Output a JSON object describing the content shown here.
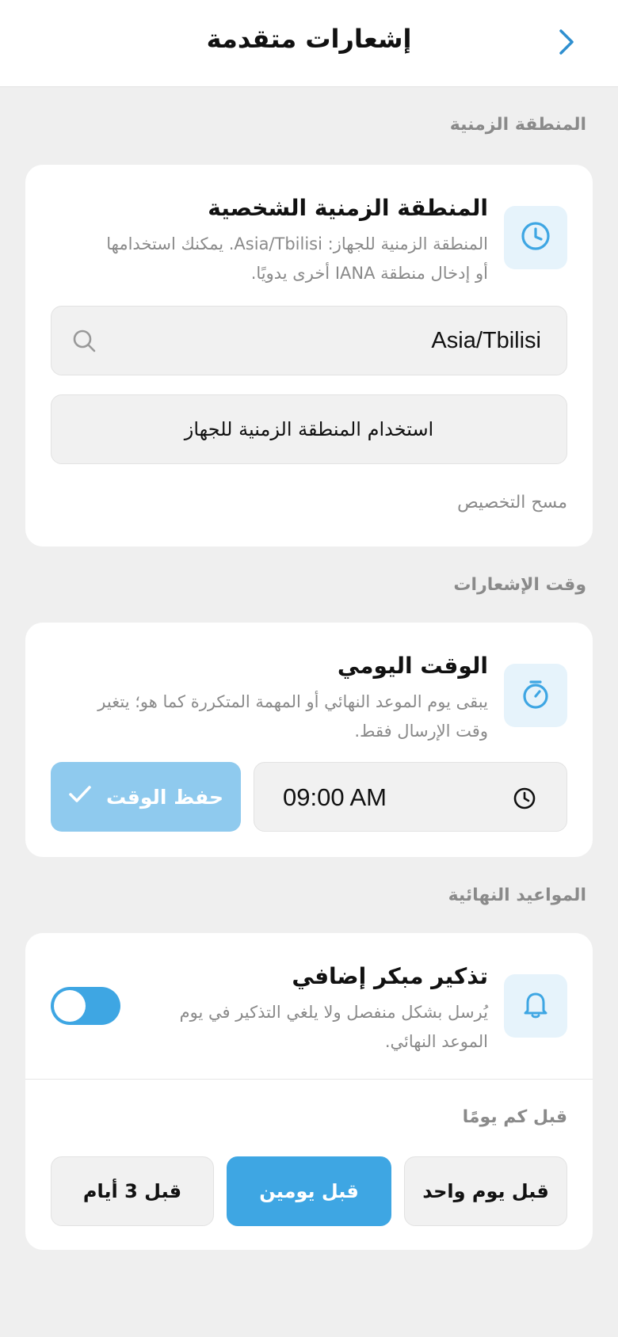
{
  "header": {
    "title": "إشعارات متقدمة",
    "back_icon": "chevron-right-icon"
  },
  "timezone_section": {
    "label": "المنطقة الزمنية",
    "card": {
      "icon": "clock-icon",
      "title": "المنطقة الزمنية الشخصية",
      "description_line1": "المنطقة الزمنية للجهاز: Asia/Tbilisi. يمكنك استخدامها",
      "description_line2": "أو إدخال منطقة IANA أخرى يدويًا.",
      "input_value": "Asia/Tbilisi",
      "search_icon": "search-icon",
      "use_device_label": "استخدام المنطقة الزمنية للجهاز",
      "reset_label": "مسح التخصيص"
    }
  },
  "notification_time_section": {
    "label": "وقت الإشعارات",
    "card": {
      "icon": "stopwatch-icon",
      "title": "الوقت اليومي",
      "description_line1": "يبقى يوم الموعد النهائي أو المهمة المتكررة كما هو؛ يتغير",
      "description_line2": "وقت الإرسال فقط.",
      "time_value": "09:00  AM",
      "time_icon": "clock-icon",
      "save_label": "حفظ الوقت",
      "save_icon": "check-icon"
    }
  },
  "deadlines_section": {
    "label": "المواعيد النهائية",
    "card": {
      "icon": "bell-icon",
      "title": "تذكير مبكر إضافي",
      "description_line1": "يُرسل بشكل منفصل ولا يلغي التذكير في يوم",
      "description_line2": "الموعد النهائي.",
      "toggle_on": true,
      "days_before_label": "قبل كم يومًا",
      "options": [
        "قبل يوم واحد",
        "قبل يومين",
        "قبل 3 أيام"
      ],
      "selected_option": "قبل يومين"
    }
  },
  "colors": {
    "accent": "#3ea6e3",
    "accent_light": "#8fcaee",
    "icon_bg": "#e6f3fb",
    "page_bg": "#efefef",
    "card_bg": "#ffffff",
    "muted_text": "#8a8a8a"
  }
}
